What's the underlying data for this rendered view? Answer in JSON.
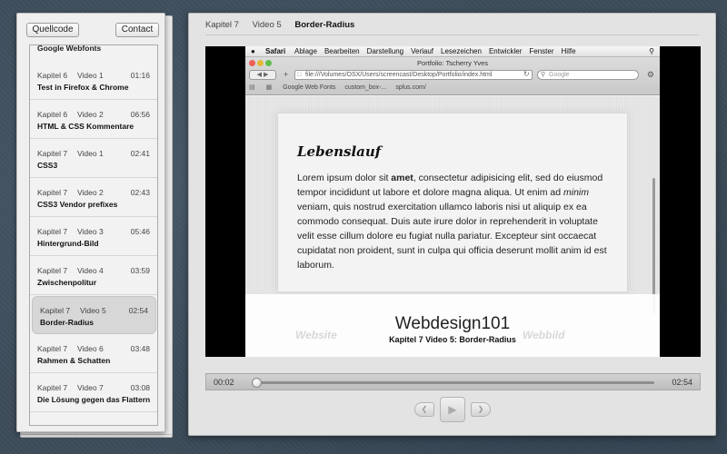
{
  "sidebar": {
    "source_button": "Quellcode",
    "contact_button": "Contact",
    "first_title": "Google Webfonts",
    "items": [
      {
        "chapter": "Kapitel 6",
        "video": "Video 1",
        "duration": "01:16",
        "title": "Test in Firefox & Chrome"
      },
      {
        "chapter": "Kapitel 6",
        "video": "Video 2",
        "duration": "06:56",
        "title": "HTML & CSS Kommentare"
      },
      {
        "chapter": "Kapitel 7",
        "video": "Video 1",
        "duration": "02:41",
        "title": "CSS3"
      },
      {
        "chapter": "Kapitel 7",
        "video": "Video 2",
        "duration": "02:43",
        "title": "CSS3 Vendor prefixes"
      },
      {
        "chapter": "Kapitel 7",
        "video": "Video 3",
        "duration": "05:46",
        "title": "Hintergrund-Bild"
      },
      {
        "chapter": "Kapitel 7",
        "video": "Video 4",
        "duration": "03:59",
        "title": "Zwischenpolitur"
      },
      {
        "chapter": "Kapitel 7",
        "video": "Video 5",
        "duration": "02:54",
        "title": "Border-Radius"
      },
      {
        "chapter": "Kapitel 7",
        "video": "Video 6",
        "duration": "03:48",
        "title": "Rahmen & Schatten"
      },
      {
        "chapter": "Kapitel 7",
        "video": "Video 7",
        "duration": "03:08",
        "title": "Die Lösung gegen das Flattern"
      }
    ]
  },
  "header": {
    "chapter": "Kapitel 7",
    "video": "Video 5",
    "title": "Border-Radius"
  },
  "screencast": {
    "menubar": {
      "app": "Safari",
      "items": [
        "Ablage",
        "Bearbeiten",
        "Darstellung",
        "Verlauf",
        "Lesezeichen",
        "Entwickler",
        "Fenster",
        "Hilfe"
      ]
    },
    "window_title": "Portfolio: Tscherry Yves",
    "url": "file:///Volumes/OSX/Users/screencast/Desktop/Portfolio/index.html",
    "search_placeholder": "Google",
    "bookmarks": [
      "Google Web Fonts",
      "custom_box-...",
      "splus.com/"
    ],
    "heading": "Lebenslauf",
    "paragraph_before_bold": "Lorem ipsum dolor sit ",
    "paragraph_bold": "amet",
    "paragraph_mid": ", consectetur adipisicing elit, sed do eiusmod tempor incididunt ut labore et dolore magna aliqua. Ut enim ad ",
    "paragraph_italic": "minim",
    "paragraph_after": " veniam, quis nostrud exercitation ullamco laboris nisi ut aliquip ex ea commodo consequat. Duis aute irure dolor in reprehenderit in voluptate velit esse cillum dolore eu fugiat nulla pariatur. Excepteur sint occaecat cupidatat non proident, sunt in culpa qui officia deserunt mollit anim id est laborum.",
    "ghost_left": "Website",
    "ghost_right": "Webbild",
    "brand": "Webdesign101",
    "caption": "Kapitel 7 Video 5: Border-Radius"
  },
  "player": {
    "elapsed": "00:02",
    "total": "02:54",
    "progress": 0.012
  },
  "active_index": 6
}
